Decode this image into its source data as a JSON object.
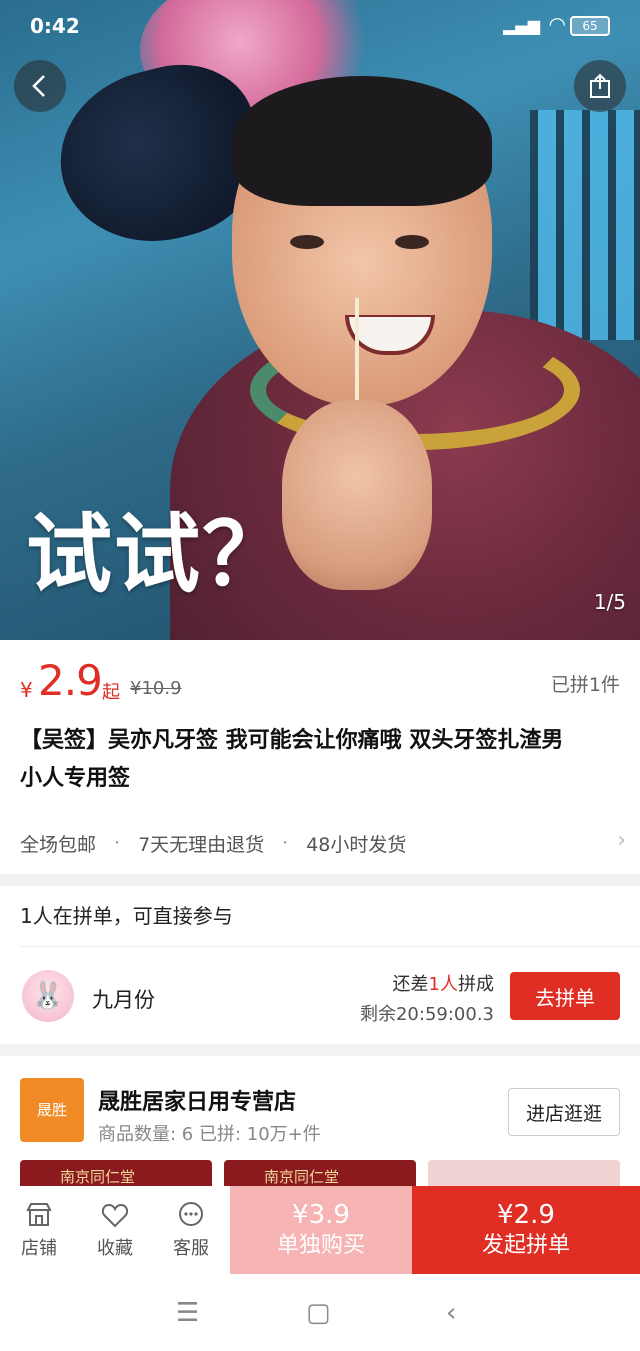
{
  "status_bar": {
    "time": "0:42",
    "battery": "65"
  },
  "hero": {
    "caption": "试试？",
    "counter": "1/5"
  },
  "price": {
    "currency": "¥",
    "value": "2.9",
    "suffix": "起",
    "original": "¥10.9",
    "sold": "已拼1件"
  },
  "product": {
    "title_line1": "【吴签】吴亦凡牙签 我可能会让你痛哦 双头牙签扎渣男",
    "title_line2": "小人专用签"
  },
  "services": [
    "全场包邮",
    "7天无理由退货",
    "48小时发货"
  ],
  "group": {
    "header": "1人在拼单，可直接参与",
    "user": "九月份",
    "need_prefix": "还差",
    "need_count": "1人",
    "need_suffix": "拼成",
    "remaining": "剩余20:59:00.3",
    "join_label": "去拼单"
  },
  "shop": {
    "logo_text": "晟胜",
    "name": "晟胜居家日用专营店",
    "meta": "商品数量: 6   已拼: 10万+件",
    "enter_label": "进店逛逛",
    "thumb_labels": [
      "南京同仁堂",
      "南京同仁堂"
    ]
  },
  "bottom_bar": {
    "tabs": [
      {
        "label": "店铺",
        "icon": "store-icon"
      },
      {
        "label": "收藏",
        "icon": "heart-icon"
      },
      {
        "label": "客服",
        "icon": "chat-icon"
      }
    ],
    "single": {
      "price": "¥3.9",
      "label": "单独购买"
    },
    "group": {
      "price": "¥2.9",
      "label": "发起拼单"
    }
  },
  "colors": {
    "accent": "#e02e24",
    "single_buy": "#f7b4b4",
    "shop_logo": "#f08a24"
  }
}
